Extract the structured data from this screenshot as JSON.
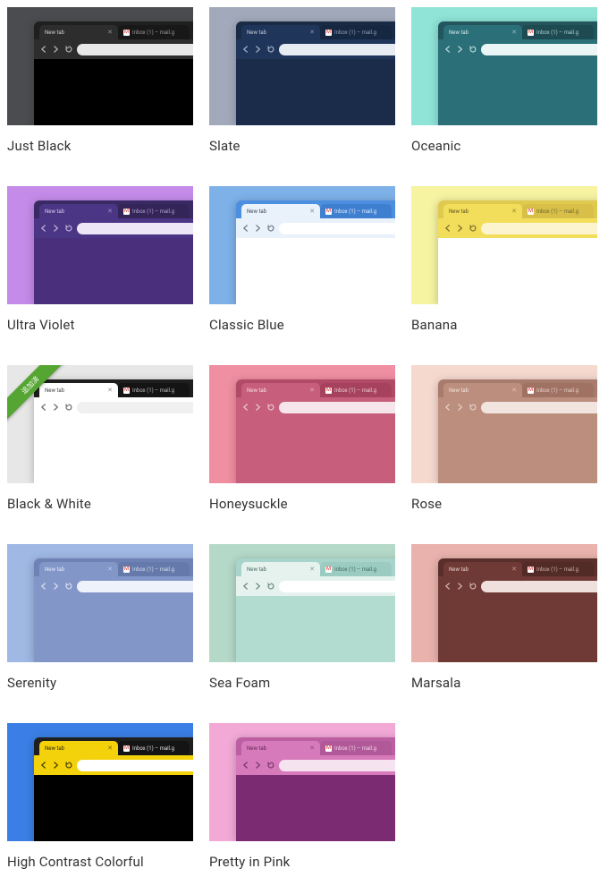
{
  "common": {
    "active_tab_label": "New tab",
    "inactive_tab_label": "Inbox (1) – mail.g",
    "ribbon_text": "追加済"
  },
  "themes": [
    {
      "name": "Just Black",
      "bg": "#4a4c4f",
      "tabstrip": "#1f1f1f",
      "active_tab": "#2d2d2d",
      "active_text": "#cfd0d1",
      "inactive_tab": "#181818",
      "inactive_text": "#9a9a9a",
      "toolbar": "#2d2d2d",
      "omni": "#e8e8e8",
      "nav_icon": "#c7c7c7",
      "page": "#000000",
      "ribbon": false
    },
    {
      "name": "Slate",
      "bg": "#a2a9bb",
      "tabstrip": "#1a2b45",
      "active_tab": "#1f355a",
      "active_text": "#c7cedb",
      "inactive_tab": "#162741",
      "inactive_text": "#90a0b8",
      "toolbar": "#1f355a",
      "omni": "#e7ebf2",
      "nav_icon": "#b9c4d6",
      "page": "#1b2b4a",
      "ribbon": false
    },
    {
      "name": "Oceanic",
      "bg": "#8fe3d7",
      "tabstrip": "#23555c",
      "active_tab": "#2b6f78",
      "active_text": "#d6ecee",
      "inactive_tab": "#1e4b51",
      "inactive_text": "#a7cfd3",
      "toolbar": "#2b6f78",
      "omni": "#eaf5f6",
      "nav_icon": "#cde6e8",
      "page": "#2b6f78",
      "ribbon": false
    },
    {
      "name": "Ultra Violet",
      "bg": "#c48be8",
      "tabstrip": "#3a2a63",
      "active_tab": "#4b3585",
      "active_text": "#d6cdea",
      "inactive_tab": "#342558",
      "inactive_text": "#b2a6cf",
      "toolbar": "#4b3585",
      "omni": "#ece6f6",
      "nav_icon": "#cfc5e6",
      "page": "#4a2f7d",
      "ribbon": false
    },
    {
      "name": "Classic Blue",
      "bg": "#7db1e8",
      "tabstrip": "#4c8fe0",
      "active_tab": "#e9f1fb",
      "active_text": "#3a4a5c",
      "inactive_tab": "#3f7fd0",
      "inactive_text": "#e3eefb",
      "toolbar": "#e9f1fb",
      "omni": "#ffffff",
      "nav_icon": "#5b6875",
      "page": "#ffffff",
      "ribbon": false
    },
    {
      "name": "Banana",
      "bg": "#f6f3a1",
      "tabstrip": "#e0c94f",
      "active_tab": "#f2de5a",
      "active_text": "#5d5020",
      "inactive_tab": "#d8c048",
      "inactive_text": "#6f622d",
      "toolbar": "#f2de5a",
      "omni": "#fbf4cf",
      "nav_icon": "#6b5d28",
      "page": "#ffffff",
      "ribbon": false
    },
    {
      "name": "Black & White",
      "bg": "#e7e7e7",
      "tabstrip": "#1e1e1e",
      "active_tab": "#ffffff",
      "active_text": "#444444",
      "inactive_tab": "#141414",
      "inactive_text": "#bdbdbd",
      "toolbar": "#ffffff",
      "omni": "#f0f0f0",
      "nav_icon": "#555555",
      "page": "#ffffff",
      "ribbon": true
    },
    {
      "name": "Honeysuckle",
      "bg": "#f08ea2",
      "tabstrip": "#b14a66",
      "active_tab": "#c65e7c",
      "active_text": "#f6dfe6",
      "inactive_tab": "#a7425e",
      "inactive_text": "#eac9d3",
      "toolbar": "#c65e7c",
      "omni": "#f6e6eb",
      "nav_icon": "#f0d5dd",
      "page": "#c65e7c",
      "ribbon": false
    },
    {
      "name": "Rose",
      "bg": "#f5d9cf",
      "tabstrip": "#a97b6c",
      "active_tab": "#bb8e7e",
      "active_text": "#f2e3dc",
      "inactive_tab": "#a07263",
      "inactive_text": "#e6d0c6",
      "toolbar": "#bb8e7e",
      "omni": "#f2e5df",
      "nav_icon": "#ecdad2",
      "page": "#bb8e7e",
      "ribbon": false
    },
    {
      "name": "Serenity",
      "bg": "#9fb8e4",
      "tabstrip": "#6e82b5",
      "active_tab": "#8296c8",
      "active_text": "#e7ecf6",
      "inactive_tab": "#6679ab",
      "inactive_text": "#d4dced",
      "toolbar": "#8296c8",
      "omni": "#eef2fa",
      "nav_icon": "#e4e9f5",
      "page": "#8296c8",
      "ribbon": false
    },
    {
      "name": "Sea Foam",
      "bg": "#b5d9c9",
      "tabstrip": "#a8d4cb",
      "active_tab": "#e5f2ee",
      "active_text": "#4b6a62",
      "inactive_tab": "#9bcbc1",
      "inactive_text": "#456b62",
      "toolbar": "#e5f2ee",
      "omni": "#ffffff",
      "nav_icon": "#5c7a72",
      "page": "#b2dccf",
      "ribbon": false
    },
    {
      "name": "Marsala",
      "bg": "#e9b2ac",
      "tabstrip": "#5a2f2b",
      "active_tab": "#6f3a35",
      "active_text": "#e6cfcb",
      "inactive_tab": "#522a26",
      "inactive_text": "#cdb0ab",
      "toolbar": "#6f3a35",
      "omni": "#efe0dd",
      "nav_icon": "#dcc5c1",
      "page": "#6f3a35",
      "ribbon": false
    },
    {
      "name": "High Contrast Colorful",
      "bg": "#3b7fe6",
      "tabstrip": "#1f1f1f",
      "active_tab": "#f4d20b",
      "active_text": "#2a2500",
      "inactive_tab": "#141414",
      "inactive_text": "#e4e4e4",
      "toolbar": "#f4d20b",
      "omni": "#ffffff",
      "nav_icon": "#2d2800",
      "page": "#000000",
      "ribbon": false
    },
    {
      "name": "Pretty in Pink",
      "bg": "#f2a9d6",
      "tabstrip": "#bb5fa2",
      "active_tab": "#d77abb",
      "active_text": "#5e2752",
      "inactive_tab": "#b05898",
      "inactive_text": "#f3d9ec",
      "toolbar": "#d77abb",
      "omni": "#f6e3f0",
      "nav_icon": "#6a2f5d",
      "page": "#7a2b72",
      "ribbon": false
    }
  ]
}
